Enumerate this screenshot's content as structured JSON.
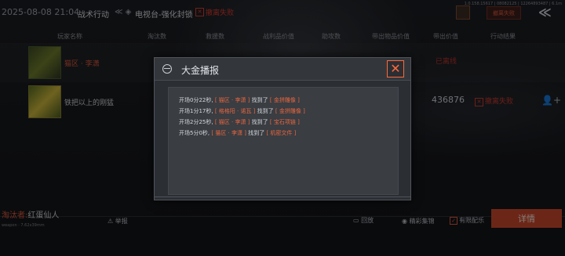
{
  "topbar": {
    "datetime": "2025-08-08 21:04",
    "mode": "战术行动",
    "separator": "≪",
    "map": "电视台-强化封锁",
    "result": "撤离失败",
    "build_info": "1.0.158.15617 | 08082125 | 12264893487 | 6.1m",
    "top_button": "撤离失败",
    "back_icon": "double-chevron-left-icon"
  },
  "headers": [
    "玩家名称",
    "淘汰数",
    "救援数",
    "战利品价值",
    "助攻数",
    "带出物品价值",
    "带出价值",
    "行动结果"
  ],
  "rows": [
    {
      "name": "猫区 · 李潇",
      "value": "已离线",
      "result": ""
    },
    {
      "name": "铁把以上的刚猛",
      "value": "436876",
      "result": "撤离失败"
    }
  ],
  "bottom": {
    "weapon_prefix": "淘汰者:",
    "weapon_name": "红蛋仙人",
    "sub": "weapon · 7.62x39mm",
    "report": "举报",
    "replay": "回放",
    "highlight": "精彩集锦",
    "share": "有限配乐",
    "details": "详情"
  },
  "modal": {
    "title": "大金播报",
    "messages": [
      {
        "time": "开场0分22秒,",
        "team": "[ 猫区 · 李潇 ]",
        "found": "找到了",
        "item": "[ 金拼雕像 ]"
      },
      {
        "time": "开场1分17秒,",
        "team": "[ 格格阳 · 诺瓦 ]",
        "found": "找到了",
        "item": "[ 金拼雕像 ]"
      },
      {
        "time": "开场2分25秒,",
        "team": "[ 猫区 · 李潇 ]",
        "found": "找到了",
        "item": "[ 宝石项链 ]"
      },
      {
        "time": "开场5分0秒,",
        "team": "[ 猫区 · 李潇 ]",
        "found": "找到了",
        "item": "[ 机密文件 ]"
      }
    ]
  },
  "colors": {
    "accent": "#e8663f",
    "fail": "#c43a2e",
    "button": "#c5452d"
  }
}
